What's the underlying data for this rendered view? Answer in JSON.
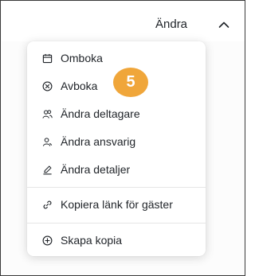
{
  "header": {
    "dropdown_label": "Ändra",
    "chevron_icon": "chevron-up-icon"
  },
  "menu": {
    "items": [
      {
        "label": "Omboka",
        "icon": "calendar-icon"
      },
      {
        "label": "Avboka",
        "icon": "cancel-circle-icon"
      },
      {
        "label": "Ändra deltagare",
        "icon": "people-icon"
      },
      {
        "label": "Ändra ansvarig",
        "icon": "person-icon"
      },
      {
        "label": "Ändra detaljer",
        "icon": "pencil-icon"
      },
      {
        "label": "Kopiera länk för gäster",
        "icon": "link-icon"
      },
      {
        "label": "Skapa kopia",
        "icon": "add-circle-icon"
      }
    ]
  },
  "step_badge": {
    "number": "5",
    "color": "#f0a63a"
  },
  "colors": {
    "text": "#1f2328",
    "frame_border": "#3a3a3a",
    "badge": "#f0a63a"
  }
}
